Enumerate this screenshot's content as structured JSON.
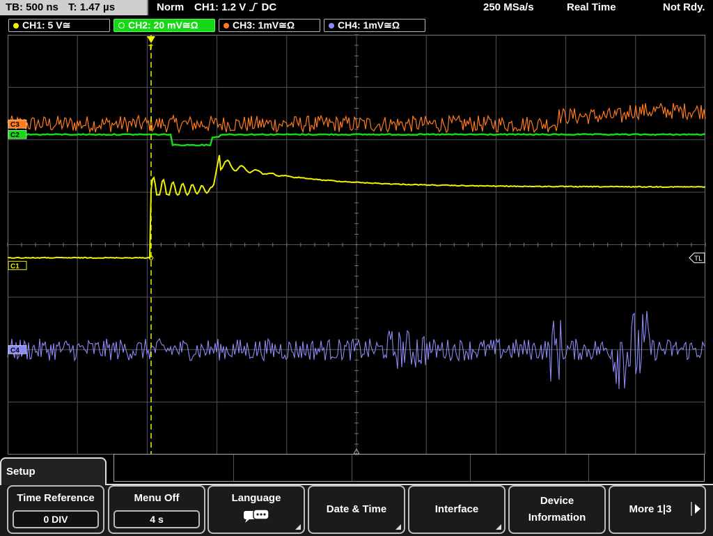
{
  "status": {
    "timebase": "TB: 500 ns",
    "trigger_time": "T: 1.47 µs",
    "mode": "Norm",
    "trigger": "CH1: 1.2 V",
    "trigger_suffix": "DC",
    "sample_rate": "250 MSa/s",
    "acq_mode": "Real Time",
    "state": "Not Rdy."
  },
  "channels": [
    {
      "label": "CH1: 5 V",
      "suffix": "≅",
      "color": "#f2f200",
      "active": false
    },
    {
      "label": "CH2: 20 mV",
      "suffix": "≅Ω",
      "color": "#17d817",
      "active": true
    },
    {
      "label": "CH3: 1mV",
      "suffix": "≅Ω",
      "color": "#ff7b1c",
      "active": false
    },
    {
      "label": "CH4: 1mV",
      "suffix": "≅Ω",
      "color": "#8b8bf5",
      "active": false
    }
  ],
  "markers": {
    "ch1": "C1",
    "ch2": "C2",
    "ch3": "C3",
    "ch4": "C4",
    "trigger_level": "TL",
    "trigger_pos": "T"
  },
  "menu": {
    "title": "Setup",
    "buttons": [
      {
        "label": "Time Reference",
        "value": "0 DIV"
      },
      {
        "label": "Menu Off",
        "value": "4 s"
      },
      {
        "label": "Language",
        "value": ""
      },
      {
        "label": "Date & Time",
        "value": ""
      },
      {
        "label": "Interface",
        "value": ""
      },
      {
        "label": "Device Information",
        "line1": "Device",
        "line2": "Information"
      },
      {
        "label": "More 1|3",
        "value": ""
      }
    ]
  },
  "colors": {
    "ch1": "#f2f200",
    "ch2": "#17d817",
    "ch3": "#ff7b1c",
    "ch4": "#8b8bf5",
    "grid": "#555555"
  },
  "chart_data": {
    "type": "line",
    "x_unit": "div",
    "grid": true,
    "x_divisions": 10,
    "y_divisions": 8,
    "series": [
      {
        "name": "CH1",
        "shape": "step then damped ringing, settles",
        "pre_level_div": -1.7,
        "post_level_div": 1.2
      },
      {
        "name": "CH2",
        "shape": "flat with small negative dip after trigger",
        "level_div": 2.1
      },
      {
        "name": "CH3",
        "shape": "noise band",
        "level_div": 2.3
      },
      {
        "name": "CH4",
        "shape": "noise band with bursts",
        "level_div": -2.0
      }
    ]
  }
}
